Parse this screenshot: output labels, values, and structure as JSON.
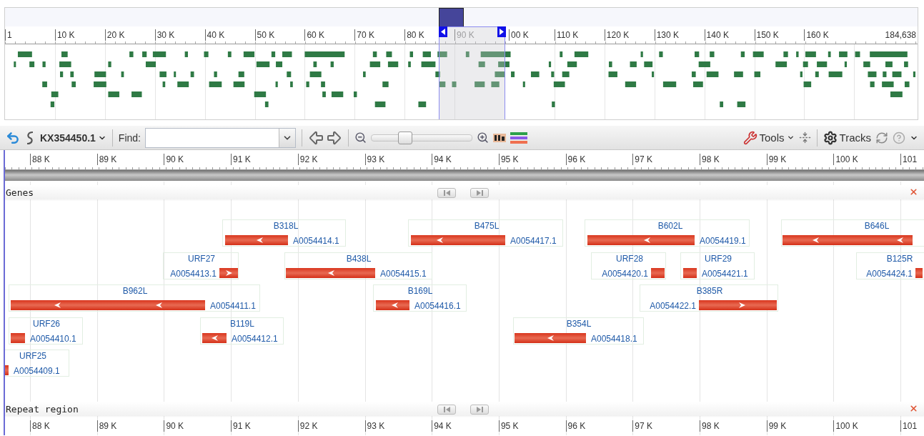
{
  "overview": {
    "ticks": [
      "1",
      "10 K",
      "20 K",
      "30 K",
      "40 K",
      "50 K",
      "60 K",
      "70 K",
      "80 K",
      "90 K",
      "00 K",
      "110 K",
      "120 K",
      "130 K",
      "140 K",
      "150 K",
      "160 K",
      "184,638"
    ]
  },
  "toolbar": {
    "reference": "KX354450.1",
    "find_label": "Find:",
    "zoom": {
      "level": 0.33
    },
    "tools": "Tools",
    "tracks": "Tracks"
  },
  "ruler": {
    "ticks": [
      "88 K",
      "89 K",
      "90 K",
      "91 K",
      "92 K",
      "93 K",
      "94 K",
      "95 K",
      "96 K",
      "97 K",
      "98 K",
      "99 K",
      "100 K",
      "101"
    ]
  },
  "tracks": [
    {
      "title": "Genes",
      "features": [
        {
          "name": "B318L",
          "locus": "A0054414.1",
          "kind": "reverse"
        },
        {
          "name": "B475L",
          "locus": "A0054417.1",
          "kind": "reverse"
        },
        {
          "name": "B602L",
          "locus": "A0054419.1",
          "kind": "reverse"
        },
        {
          "name": "B646L",
          "kind": "reverse"
        },
        {
          "name": "URF27",
          "locus": "A0054413.1",
          "kind": "forward"
        },
        {
          "name": "B438L",
          "locus": "A0054415.1",
          "kind": "reverse"
        },
        {
          "name": "URF28",
          "locus": "A0054420.1"
        },
        {
          "name": "URF29",
          "locus": "A0054421.1"
        },
        {
          "name": "B125R",
          "locus": "A0054424.1"
        },
        {
          "name": "B962L",
          "locus": "A0054411.1",
          "kind": "reverse"
        },
        {
          "name": "B169L",
          "locus": "A0054416.1",
          "kind": "reverse"
        },
        {
          "name": "B385R",
          "locus": "A0054422.1",
          "kind": "forward"
        },
        {
          "name": "URF26",
          "locus": "A0054410.1"
        },
        {
          "name": "B119L",
          "locus": "A0054412.1",
          "kind": "reverse"
        },
        {
          "name": "B354L",
          "locus": "A0054418.1",
          "kind": "reverse"
        },
        {
          "name": "URF25",
          "locus": "A0054409.1"
        }
      ]
    },
    {
      "title": "Repeat region"
    }
  ],
  "bottom_ruler": {
    "ticks": [
      "88 K",
      "89 K",
      "90 K",
      "91 K",
      "92 K",
      "93 K",
      "94 K",
      "95 K",
      "96 K",
      "97 K",
      "98 K",
      "99 K",
      "100 K",
      "101"
    ]
  }
}
